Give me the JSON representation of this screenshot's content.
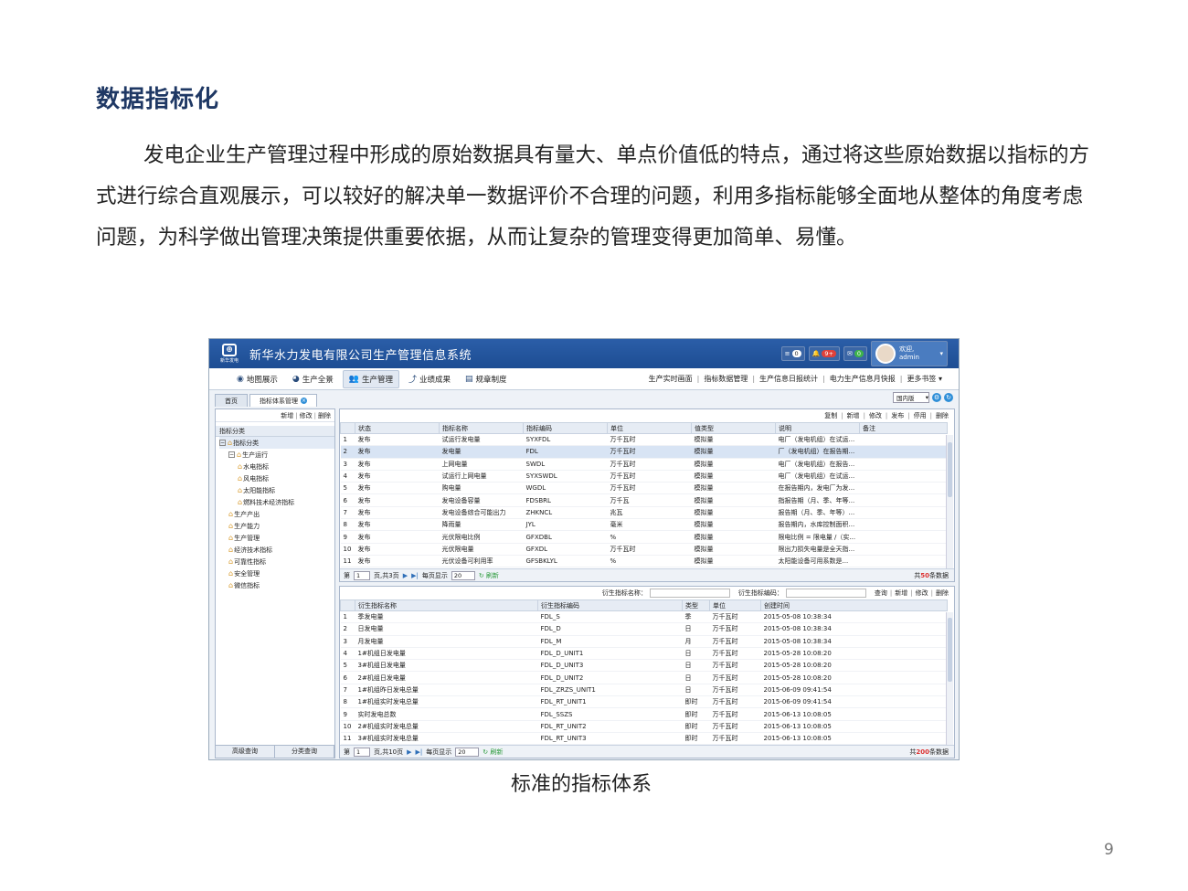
{
  "doc": {
    "title": "数据指标化",
    "paragraph": "发电企业生产管理过程中形成的原始数据具有量大、单点价值低的特点，通过将这些原始数据以指标的方式进行综合直观展示，可以较好的解决单一数据评价不合理的问题，利用多指标能够全面地从整体的角度考虑问题，为科学做出管理决策提供重要依据，从而让复杂的管理变得更加简单、易懂。",
    "caption": "标准的指标体系",
    "page_number": "9"
  },
  "app": {
    "logo_text": "新华发电",
    "title": "新华水力发电有限公司生产管理信息系统",
    "top_buttons": [
      {
        "icon": "list-icon",
        "count": "0"
      },
      {
        "icon": "bell-icon",
        "count": "9+"
      },
      {
        "icon": "mail-icon",
        "count": "0"
      }
    ],
    "user": {
      "greeting": "欢迎,",
      "name": "admin"
    },
    "nav_left": [
      {
        "label": "地图展示",
        "icon": "globe-icon",
        "glyph": "◉"
      },
      {
        "label": "生产全景",
        "icon": "pie-icon",
        "glyph": "◕"
      },
      {
        "label": "生产管理",
        "icon": "users-icon",
        "glyph": "👥"
      },
      {
        "label": "业绩成果",
        "icon": "chart-line-icon",
        "glyph": "⤴"
      },
      {
        "label": "规章制度",
        "icon": "document-icon",
        "glyph": "▤"
      }
    ],
    "nav_right": [
      "生产实时画面",
      "指标数据管理",
      "生产信息日报统计",
      "电力生产信息月快报",
      "更多书签 ▾"
    ],
    "tabs": [
      {
        "label": "首页"
      },
      {
        "label": "指标体系管理"
      }
    ],
    "tab_select": "国内版",
    "left_toolbar": [
      "新增",
      "修改",
      "删除"
    ],
    "tree_header": "指标分类",
    "tree": [
      {
        "label": "指标分类",
        "level": 0,
        "toggle": "−"
      },
      {
        "label": "生产运行",
        "level": 1,
        "toggle": "−"
      },
      {
        "label": "水电指标",
        "level": 2,
        "toggle": ""
      },
      {
        "label": "风电指标",
        "level": 2,
        "toggle": ""
      },
      {
        "label": "太阳能指标",
        "level": 2,
        "toggle": ""
      },
      {
        "label": "燃料技术经济指标",
        "level": 2,
        "toggle": ""
      },
      {
        "label": "生产产出",
        "level": 1,
        "toggle": ""
      },
      {
        "label": "生产能力",
        "level": 1,
        "toggle": ""
      },
      {
        "label": "生产管理",
        "level": 1,
        "toggle": ""
      },
      {
        "label": "经济技术指标",
        "level": 1,
        "toggle": ""
      },
      {
        "label": "可靠性指标",
        "level": 1,
        "toggle": ""
      },
      {
        "label": "安全管理",
        "level": 1,
        "toggle": ""
      },
      {
        "label": "微信指标",
        "level": 1,
        "toggle": ""
      }
    ],
    "left_bottom": [
      "高级查询",
      "分类查询"
    ],
    "upper_toolbar": [
      "复制",
      "新增",
      "修改",
      "发布",
      "停用",
      "删除"
    ],
    "upper_columns": [
      "",
      "状态",
      "指标名称",
      "指标编码",
      "单位",
      "值类型",
      "说明",
      "备注"
    ],
    "upper_rows": [
      [
        "1",
        "发布",
        "试运行发电量",
        "SYXFDL",
        "万千瓦时",
        "模拟量",
        "电厂（发电机组）在试运...",
        ""
      ],
      [
        "2",
        "发布",
        "发电量",
        "FDL",
        "万千瓦时",
        "模拟量",
        "厂（发电机组）在报告期...",
        ""
      ],
      [
        "3",
        "发布",
        "上网电量",
        "SWDL",
        "万千瓦时",
        "模拟量",
        "电厂（发电机组）在报告...",
        ""
      ],
      [
        "4",
        "发布",
        "试运行上网电量",
        "SYXSWDL",
        "万千瓦时",
        "模拟量",
        "电厂（发电机组）在试运...",
        ""
      ],
      [
        "5",
        "发布",
        "购电量",
        "WGDL",
        "万千瓦时",
        "模拟量",
        "在报告期内，发电厂为发...",
        ""
      ],
      [
        "6",
        "发布",
        "发电设备容量",
        "FDSBRL",
        "万千瓦",
        "模拟量",
        "指报告期（月、季、年等...",
        ""
      ],
      [
        "7",
        "发布",
        "发电设备综合可能出力",
        "ZHKNCL",
        "兆瓦",
        "模拟量",
        "报告期（月、季、年等）...",
        ""
      ],
      [
        "8",
        "发布",
        "降雨量",
        "JYL",
        "毫米",
        "模拟量",
        "报告期内，水库控制面积...",
        ""
      ],
      [
        "9",
        "发布",
        "光伏限电比例",
        "GFXDBL",
        "%",
        "模拟量",
        "限电比例 = 限电量 /（实...",
        ""
      ],
      [
        "10",
        "发布",
        "光伏限电量",
        "GFXDL",
        "万千瓦时",
        "模拟量",
        "限出力损失电量是全天指...",
        ""
      ],
      [
        "11",
        "发布",
        "光伏设备可利用率",
        "GFSBKLYL",
        "%",
        "模拟量",
        "太阳能设备可用系数是...",
        ""
      ]
    ],
    "upper_pager": {
      "page_label": "第",
      "page": "1",
      "of_pages": "页,共3页",
      "per_page_label": "每页显示",
      "per_page": "20",
      "refresh": "刷新",
      "total_prefix": "共",
      "total": "50",
      "total_suffix": "条数据"
    },
    "lower_search": {
      "label1": "衍生指标名称：",
      "label2": "衍生指标编码：",
      "buttons": [
        "查询",
        "新增",
        "修改",
        "删除"
      ]
    },
    "lower_columns": [
      "",
      "衍生指标名称",
      "衍生指标编码",
      "类型",
      "单位",
      "创建时间"
    ],
    "lower_rows": [
      [
        "1",
        "季发电量",
        "FDL_S",
        "季",
        "万千瓦时",
        "2015-05-08 10:38:34"
      ],
      [
        "2",
        "日发电量",
        "FDL_D",
        "日",
        "万千瓦时",
        "2015-05-08 10:38:34"
      ],
      [
        "3",
        "月发电量",
        "FDL_M",
        "月",
        "万千瓦时",
        "2015-05-08 10:38:34"
      ],
      [
        "4",
        "1#机组日发电量",
        "FDL_D_UNIT1",
        "日",
        "万千瓦时",
        "2015-05-28 10:08:20"
      ],
      [
        "5",
        "3#机组日发电量",
        "FDL_D_UNIT3",
        "日",
        "万千瓦时",
        "2015-05-28 10:08:20"
      ],
      [
        "6",
        "2#机组日发电量",
        "FDL_D_UNIT2",
        "日",
        "万千瓦时",
        "2015-05-28 10:08:20"
      ],
      [
        "7",
        "1#机组昨日发电总量",
        "FDL_ZRZS_UNIT1",
        "日",
        "万千瓦时",
        "2015-06-09 09:41:54"
      ],
      [
        "8",
        "1#机组实时发电总量",
        "FDL_RT_UNIT1",
        "即时",
        "万千瓦时",
        "2015-06-09 09:41:54"
      ],
      [
        "9",
        "实时发电总数",
        "FDL_SSZS",
        "即时",
        "万千瓦时",
        "2015-06-13 10:08:05"
      ],
      [
        "10",
        "2#机组实时发电总量",
        "FDL_RT_UNIT2",
        "即时",
        "万千瓦时",
        "2015-06-13 10:08:05"
      ],
      [
        "11",
        "3#机组实时发电总量",
        "FDL_RT_UNIT3",
        "即时",
        "万千瓦时",
        "2015-06-13 10:08:05"
      ]
    ],
    "lower_pager": {
      "page_label": "第",
      "page": "1",
      "of_pages": "页,共10页",
      "per_page_label": "每页显示",
      "per_page": "20",
      "refresh": "刷新",
      "total_prefix": "共",
      "total": "200",
      "total_suffix": "条数据"
    }
  },
  "colors": {
    "title": "#1f3864",
    "header_bar": "#2b5ea8",
    "highlight_row": "#d8e4f4",
    "total_red": "#dd3333"
  }
}
